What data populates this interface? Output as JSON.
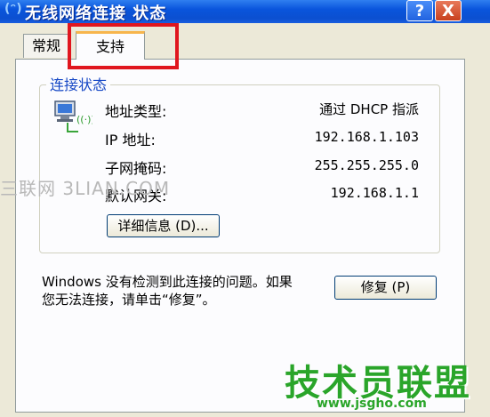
{
  "window": {
    "title": "无线网络连接 状态",
    "title_icon": "(ᵔ)",
    "help_label": "?",
    "close_label": "X"
  },
  "tabs": [
    {
      "label": "常规",
      "selected": false
    },
    {
      "label": "支持",
      "selected": true
    }
  ],
  "connection_status": {
    "group_title": "连接状态",
    "rows": [
      {
        "label": "地址类型:",
        "value": "通过 DHCP 指派"
      },
      {
        "label": "IP 地址:",
        "value": "192.168.1.103"
      },
      {
        "label": "子网掩码:",
        "value": "255.255.255.0"
      },
      {
        "label": "默认网关:",
        "value": "192.168.1.1"
      }
    ],
    "details_button": "详细信息 (D)..."
  },
  "repair": {
    "message_line1": "Windows 没有检测到此连接的问题。如果",
    "message_line2": "您无法连接，请单击“修复”。",
    "button": "修复 (P)"
  },
  "watermarks": {
    "left": "三联网 3LIAN.COM",
    "brand": "技术员联盟",
    "url": "www.jsgho.com"
  },
  "colors": {
    "highlight": "#e0161e",
    "group_title": "#1547c5"
  }
}
